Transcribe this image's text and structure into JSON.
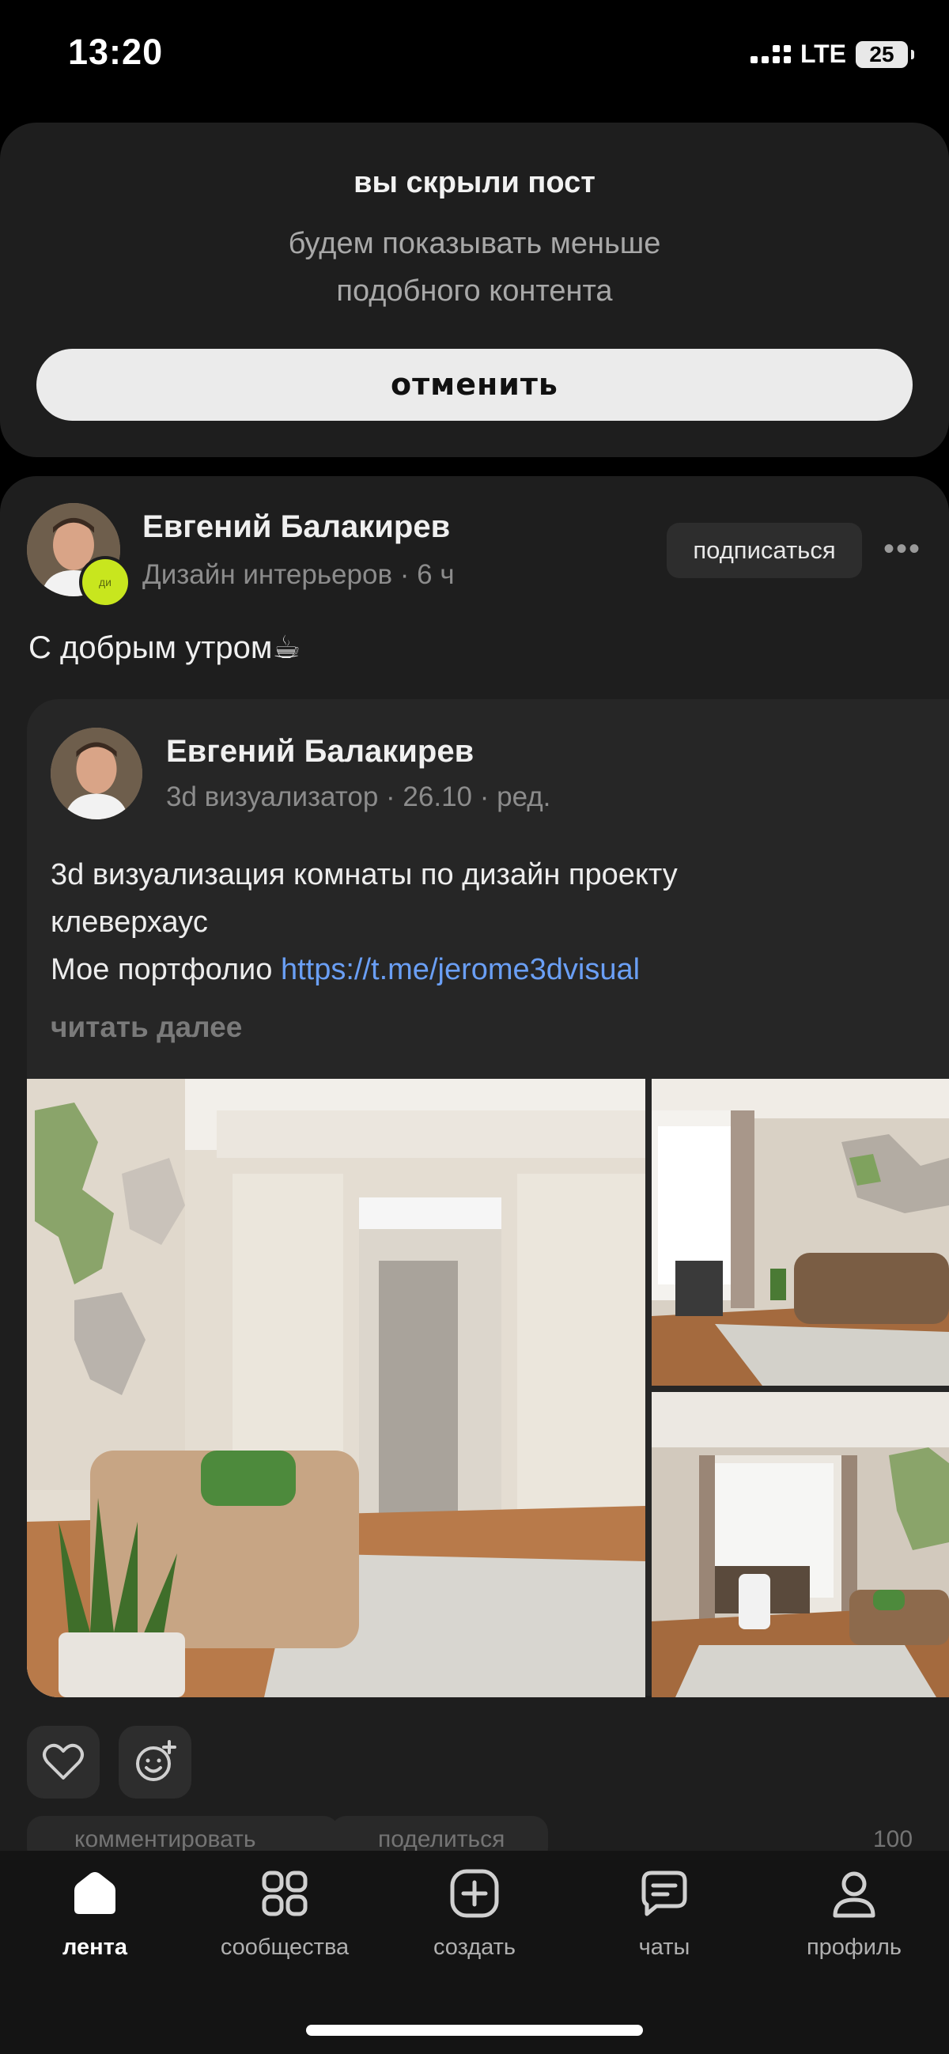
{
  "status_bar": {
    "time": "13:20",
    "network": "LTE",
    "battery": "25"
  },
  "hidden_notice": {
    "title": "вы скрыли пост",
    "subtitle_line1": "будем показывать меньше",
    "subtitle_line2": "подобного контента",
    "cancel_label": "отменить"
  },
  "post": {
    "author": "Евгений Балакирев",
    "meta": "Дизайн интерьеров · 6 ч",
    "badge": "ди",
    "subscribe_label": "подписаться",
    "more_label": "•••",
    "text": "С добрым утром☕",
    "repost": {
      "author": "Евгений Балакирев",
      "meta": "3d визуализатор · 26.10 · ред.",
      "text_line1": "3d визуализация комнаты по дизайн проекту",
      "text_line2": "клеверхаус",
      "text_line3_prefix": "Мое портфолио ",
      "link": "https://t.me/jerome3dvisual",
      "read_more": "читать далее"
    },
    "actions": {
      "comment": "комментировать",
      "share": "поделиться",
      "views": "100"
    }
  },
  "bottom_nav": [
    {
      "label": "лента",
      "icon": "home-icon"
    },
    {
      "label": "сообщества",
      "icon": "communities-icon"
    },
    {
      "label": "создать",
      "icon": "create-icon"
    },
    {
      "label": "чаты",
      "icon": "chats-icon"
    },
    {
      "label": "профиль",
      "icon": "profile-icon"
    }
  ]
}
